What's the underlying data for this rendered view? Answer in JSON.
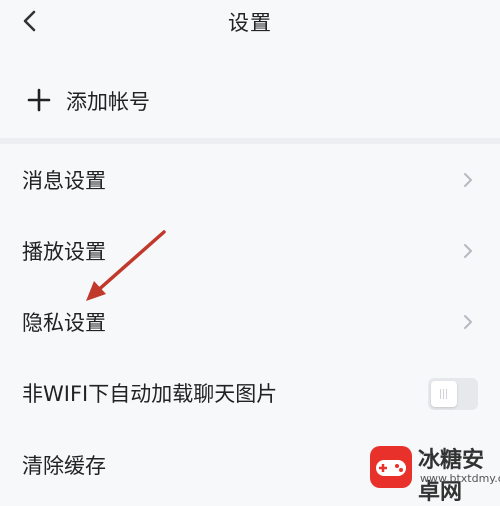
{
  "header": {
    "title": "设置",
    "back_icon": "chevron-left-icon"
  },
  "add_account": {
    "label": "添加帐号",
    "icon": "plus-icon"
  },
  "settings": [
    {
      "label": "消息设置",
      "icon": "chevron-right-icon"
    },
    {
      "label": "播放设置",
      "icon": "chevron-right-icon"
    },
    {
      "label": "隐私设置",
      "icon": "chevron-right-icon"
    },
    {
      "label": "非WIFI下自动加载聊天图片",
      "toggle_on": false
    },
    {
      "label": "清除缓存"
    }
  ],
  "annotation": {
    "arrow_color": "#c0392b"
  },
  "watermark": {
    "name": "冰糖安卓网",
    "url": "www.btxtdmy.com"
  },
  "colors": {
    "background": "#f7f8fa",
    "divider": "#eceef2",
    "text": "#222222",
    "chevron": "#b5b9c0"
  }
}
